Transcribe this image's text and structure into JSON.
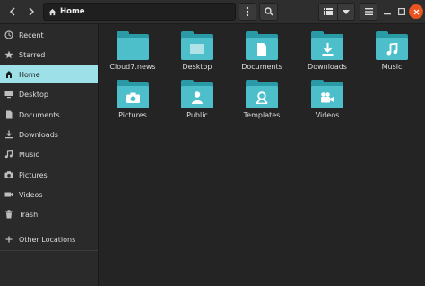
{
  "header": {
    "path_label": "Home"
  },
  "sidebar": {
    "items": [
      {
        "label": "Recent",
        "icon": "clock-icon"
      },
      {
        "label": "Starred",
        "icon": "star-icon"
      },
      {
        "label": "Home",
        "icon": "home-icon",
        "active": true
      },
      {
        "label": "Desktop",
        "icon": "desktop-icon"
      },
      {
        "label": "Documents",
        "icon": "document-icon"
      },
      {
        "label": "Downloads",
        "icon": "download-icon"
      },
      {
        "label": "Music",
        "icon": "music-icon"
      },
      {
        "label": "Pictures",
        "icon": "camera-icon"
      },
      {
        "label": "Videos",
        "icon": "video-icon"
      },
      {
        "label": "Trash",
        "icon": "trash-icon"
      },
      {
        "label": "Other Locations",
        "icon": "plus-icon"
      }
    ]
  },
  "files": [
    {
      "name": "Cloud7.news",
      "icon": "plain-folder-icon"
    },
    {
      "name": "Desktop",
      "icon": "desktop-folder-icon"
    },
    {
      "name": "Documents",
      "icon": "document-folder-icon"
    },
    {
      "name": "Downloads",
      "icon": "download-folder-icon"
    },
    {
      "name": "Music",
      "icon": "music-folder-icon"
    },
    {
      "name": "Pictures",
      "icon": "camera-folder-icon"
    },
    {
      "name": "Public",
      "icon": "person-folder-icon"
    },
    {
      "name": "Templates",
      "icon": "template-folder-icon"
    },
    {
      "name": "Videos",
      "icon": "video-folder-icon"
    }
  ],
  "colors": {
    "accent": "#9de0e7",
    "folder_light": "#4dbfcb",
    "folder_dark": "#2a9aa6",
    "close_button": "#e95420"
  }
}
